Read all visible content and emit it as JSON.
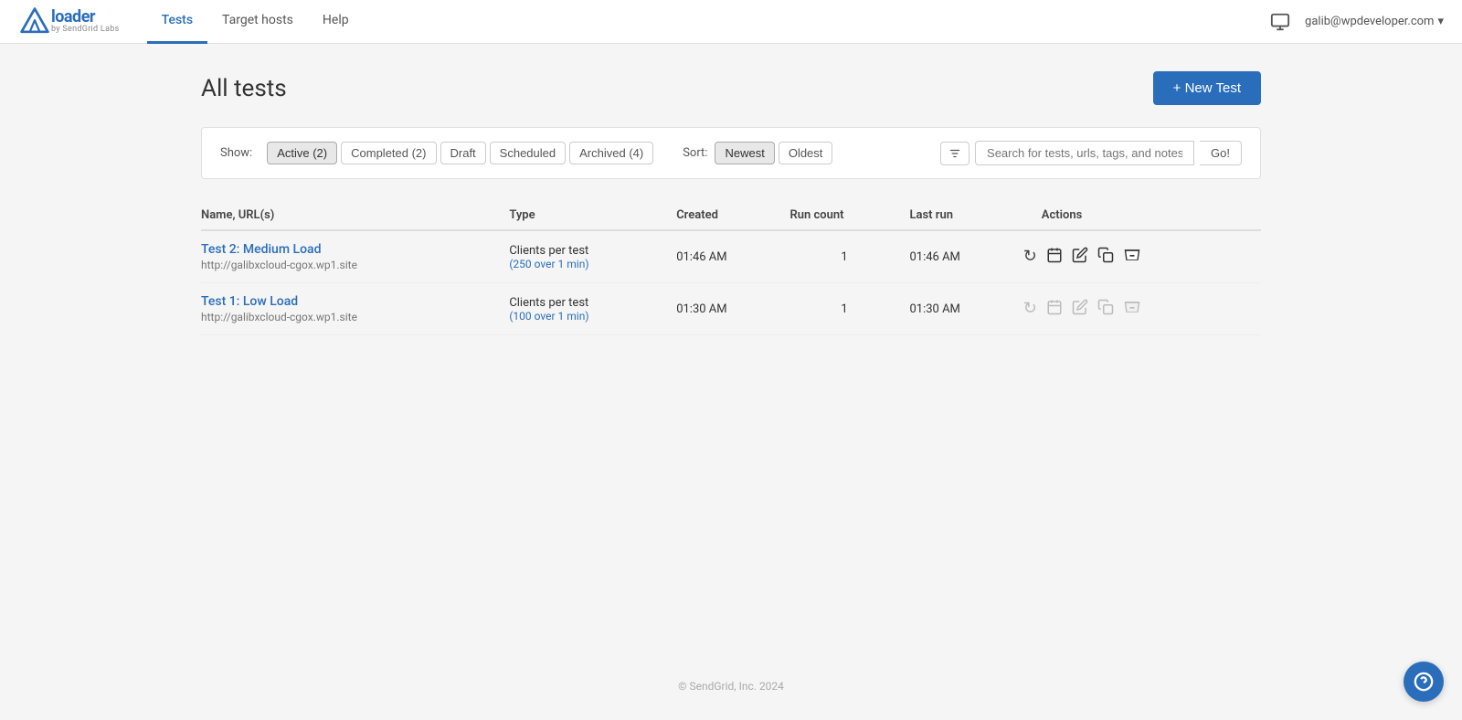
{
  "brand": {
    "loader_text": "loader",
    "sub_text": "by SendGrid Labs",
    "logo_alt": "Loader Logo"
  },
  "nav": {
    "links": [
      {
        "label": "Tests",
        "active": true
      },
      {
        "label": "Target hosts",
        "active": false
      },
      {
        "label": "Help",
        "active": false
      }
    ],
    "user_email": "galib@wpdeveloper.com",
    "user_dropdown": "▾"
  },
  "page": {
    "title": "All tests",
    "new_test_label": "+ New Test"
  },
  "filter_bar": {
    "show_label": "Show:",
    "sort_label": "Sort:",
    "tabs": [
      {
        "label": "Active (2)",
        "active": true
      },
      {
        "label": "Completed (2)",
        "active": false
      },
      {
        "label": "Draft",
        "active": false
      },
      {
        "label": "Scheduled",
        "active": false
      },
      {
        "label": "Archived (4)",
        "active": false
      }
    ],
    "sort_options": [
      {
        "label": "Newest",
        "active": true
      },
      {
        "label": "Oldest",
        "active": false
      }
    ],
    "search_placeholder": "Search for tests, urls, tags, and notes",
    "search_go_label": "Go!"
  },
  "table": {
    "columns": [
      "Name, URL(s)",
      "Type",
      "Created",
      "Run count",
      "Last run",
      "Actions"
    ],
    "rows": [
      {
        "name": "Test 2: Medium Load",
        "url": "http://galibxcloud-cgox.wp1.site",
        "type_label": "Clients per test",
        "type_detail": "(250 over 1 min)",
        "created": "01:46  AM",
        "run_count": "1",
        "last_run": "01:46  AM",
        "actions_enabled": true
      },
      {
        "name": "Test 1: Low Load",
        "url": "http://galibxcloud-cgox.wp1.site",
        "type_label": "Clients per test",
        "type_detail": "(100 over 1 min)",
        "created": "01:30  AM",
        "run_count": "1",
        "last_run": "01:30  AM",
        "actions_enabled": false
      }
    ]
  },
  "footer": {
    "text": "© SendGrid, Inc. 2024"
  }
}
